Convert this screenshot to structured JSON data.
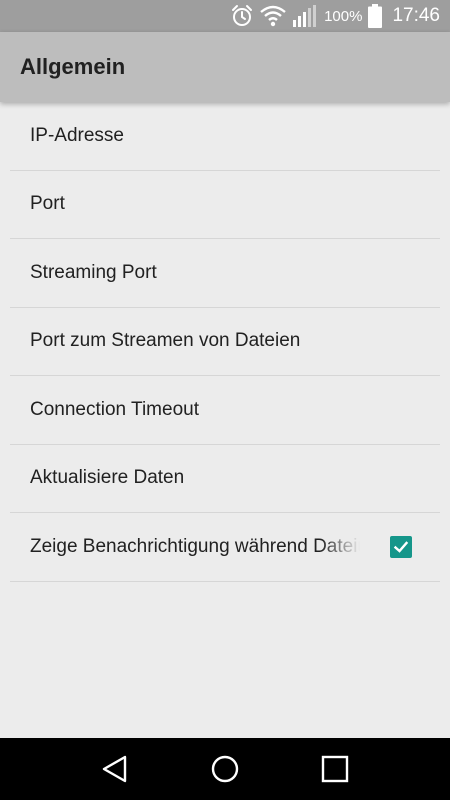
{
  "status_bar": {
    "battery_percent": "100%",
    "time": "17:46",
    "icons": [
      "alarm-icon",
      "wifi-icon",
      "signal-icon",
      "battery-icon"
    ]
  },
  "app_bar": {
    "title": "Allgemein"
  },
  "preferences": [
    {
      "label": "IP-Adresse"
    },
    {
      "label": "Port"
    },
    {
      "label": "Streaming Port"
    },
    {
      "label": "Port zum Streamen von Dateien"
    },
    {
      "label": "Connection Timeout"
    },
    {
      "label": "Aktualisiere Daten"
    },
    {
      "label": "Zeige Benachrichtigung während Dateiübertragung",
      "checked": true
    }
  ],
  "nav_bar": {
    "icons": [
      "back-icon",
      "home-icon",
      "recents-icon"
    ]
  },
  "colors": {
    "accent": "#15968a",
    "app_bar": "#bdbdbd",
    "status_bar": "#9e9e9e",
    "background": "#ececec"
  }
}
